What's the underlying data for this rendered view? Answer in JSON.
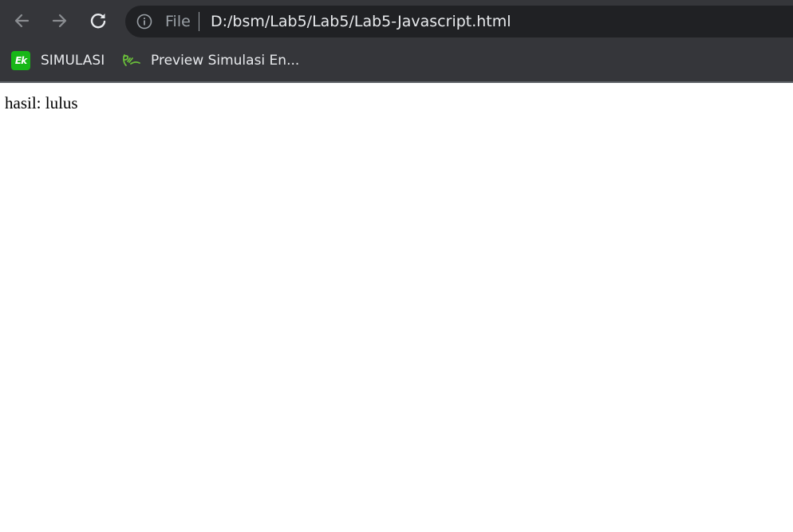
{
  "toolbar": {
    "icons": {
      "back": "back-arrow-icon",
      "forward": "forward-arrow-icon",
      "reload": "reload-icon",
      "info": "info-icon"
    },
    "omnibox": {
      "scheme_label": "File",
      "url": "D:/bsm/Lab5/Lab5/Lab5-Javascript.html"
    }
  },
  "bookmarks": [
    {
      "label": "SIMULASI",
      "favicon_text": "Ek",
      "favicon_color": "#18b718"
    },
    {
      "label": "Preview Simulasi En...",
      "favicon_color": "#6abf3a"
    }
  ],
  "page": {
    "result_text": "hasil: lulus"
  },
  "colors": {
    "chrome_bg": "#35363a",
    "omnibox_bg": "#202124",
    "text_light": "#e8eaed",
    "text_muted": "#9aa0a6",
    "page_bg": "#ffffff"
  }
}
